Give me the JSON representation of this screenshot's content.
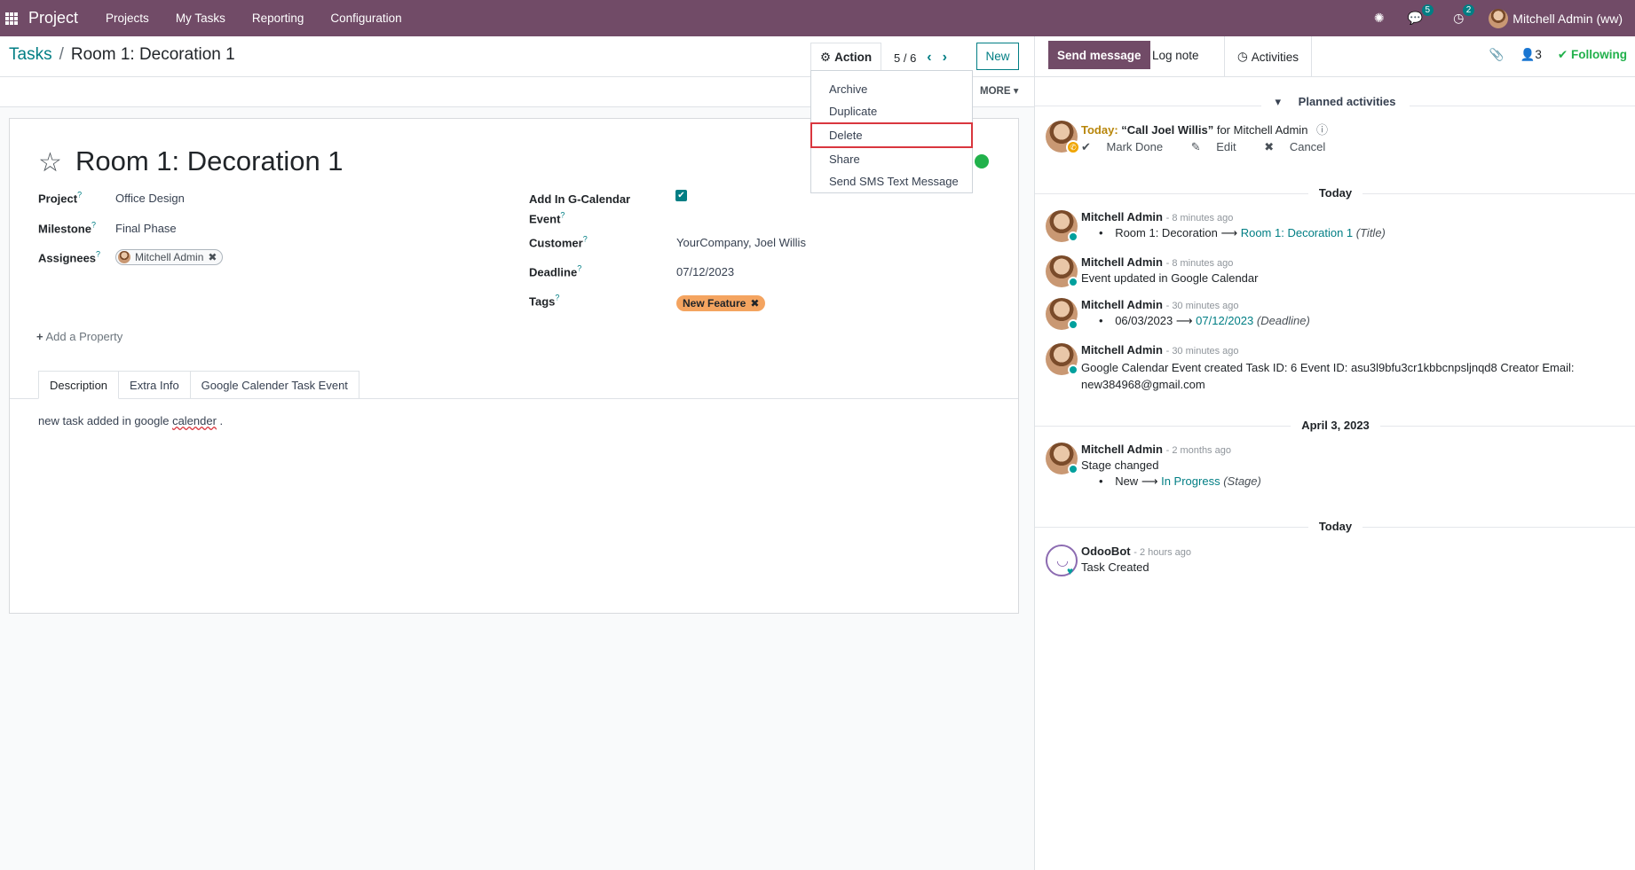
{
  "navbar": {
    "brand": "Project",
    "menu": [
      "Projects",
      "My Tasks",
      "Reporting",
      "Configuration"
    ],
    "messages_count": "5",
    "activities_count": "2",
    "user": "Mitchell Admin (ww)"
  },
  "breadcrumb": {
    "parent": "Tasks",
    "separator": "/",
    "current": "Room 1: Decoration 1"
  },
  "control": {
    "action_label": "Action",
    "pager": "5 / 6",
    "new_label": "New",
    "more_label": "MORE"
  },
  "dropdown": {
    "items": [
      "Archive",
      "Duplicate",
      "Delete",
      "Share",
      "Send SMS Text Message"
    ]
  },
  "form": {
    "title": "Room 1: Decoration 1",
    "project_label": "Project",
    "project": "Office Design",
    "milestone_label": "Milestone",
    "milestone": "Final Phase",
    "assignees_label": "Assignees",
    "assignee": "Mitchell Admin",
    "gcal_label_1": "Add In G-Calendar",
    "gcal_label_2": "Event",
    "customer_label": "Customer",
    "customer": "YourCompany, Joel Willis",
    "deadline_label": "Deadline",
    "deadline": "07/12/2023",
    "tags_label": "Tags",
    "tag": "New Feature",
    "add_property": "Add a Property",
    "tabs": [
      "Description",
      "Extra Info",
      "Google Calender Task Event"
    ],
    "description_pre": "new task added in google ",
    "description_word": "calender",
    "description_post": " ."
  },
  "chatter": {
    "send_message": "Send message",
    "log_note": "Log note",
    "activities": "Activities",
    "followers_count": "3",
    "following": "Following",
    "planned_activities": "Planned activities",
    "activity": {
      "today": "Today:",
      "summary": "“Call Joel Willis”",
      "for_text": "for Mitchell Admin",
      "mark_done": "Mark Done",
      "edit": "Edit",
      "cancel": "Cancel"
    },
    "day_today": "Today",
    "day_april": "April 3, 2023",
    "day_today_2": "Today",
    "messages": [
      {
        "author": "Mitchell Admin",
        "time": "- 8 minutes ago",
        "old": "Room 1: Decoration",
        "new": "Room 1: Decoration 1",
        "field": "(Title)"
      },
      {
        "author": "Mitchell Admin",
        "time": "- 8 minutes ago",
        "text": "Event updated in Google Calendar"
      },
      {
        "author": "Mitchell Admin",
        "time": "- 30 minutes ago",
        "old": "06/03/2023",
        "new": "07/12/2023",
        "field": "(Deadline)"
      },
      {
        "author": "Mitchell Admin",
        "time": "- 30 minutes ago",
        "text": "Google Calendar Event created Task ID: 6 Event ID: asu3l9bfu3cr1kbbcnpsljnqd8 Creator Email:",
        "text2": "new384968@gmail.com"
      },
      {
        "author": "Mitchell Admin",
        "time": "- 2 months ago",
        "text": "Stage changed",
        "old": "New",
        "new": "In Progress",
        "field": "(Stage)"
      },
      {
        "author": "OdooBot",
        "time": "- 2 hours ago",
        "text": "Task Created"
      }
    ]
  }
}
